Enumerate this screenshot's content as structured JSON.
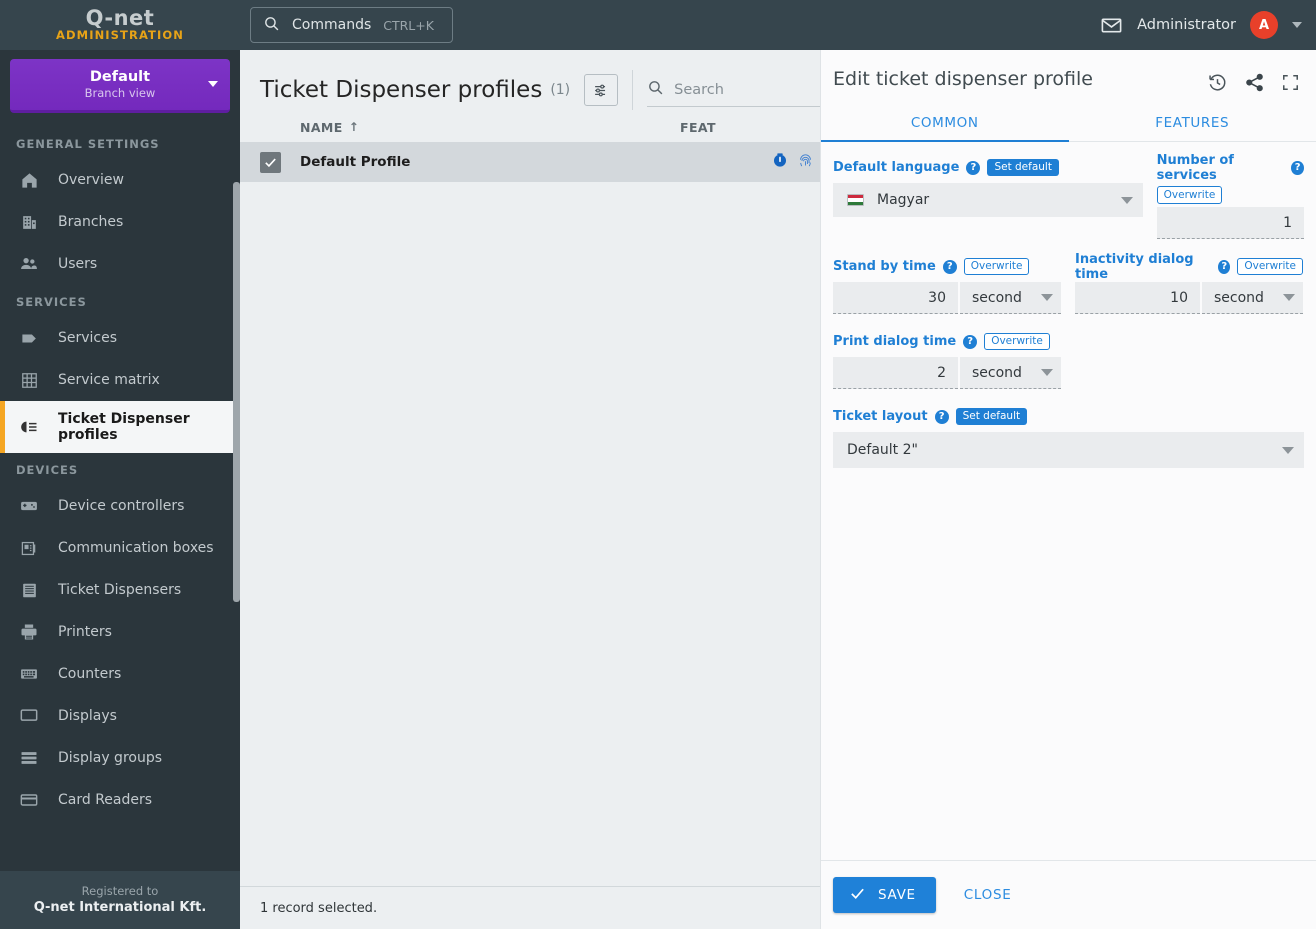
{
  "brand": {
    "logo": "Q-net",
    "subtitle": "ADMINISTRATION"
  },
  "branch": {
    "name": "Default",
    "view": "Branch view"
  },
  "topbar": {
    "commands_label": "Commands",
    "commands_shortcut": "CTRL+K",
    "user_name": "Administrator",
    "avatar_initial": "A"
  },
  "sidebar": {
    "sections": [
      {
        "title": "GENERAL SETTINGS",
        "items": [
          {
            "label": "Overview",
            "icon": "home-icon",
            "active": false
          },
          {
            "label": "Branches",
            "icon": "building-icon",
            "active": false
          },
          {
            "label": "Users",
            "icon": "users-icon",
            "active": false
          }
        ]
      },
      {
        "title": "SERVICES",
        "items": [
          {
            "label": "Services",
            "icon": "tag-icon",
            "active": false
          },
          {
            "label": "Service matrix",
            "icon": "grid-icon",
            "active": false
          },
          {
            "label": "Ticket Dispenser profiles",
            "icon": "ticket-profile-icon",
            "active": true
          }
        ]
      },
      {
        "title": "DEVICES",
        "items": [
          {
            "label": "Device controllers",
            "icon": "controller-icon",
            "active": false
          },
          {
            "label": "Communication boxes",
            "icon": "comm-box-icon",
            "active": false
          },
          {
            "label": "Ticket Dispensers",
            "icon": "ticket-dispenser-icon",
            "active": false
          },
          {
            "label": "Printers",
            "icon": "printer-icon",
            "active": false
          },
          {
            "label": "Counters",
            "icon": "counter-icon",
            "active": false
          },
          {
            "label": "Displays",
            "icon": "display-icon",
            "active": false
          },
          {
            "label": "Display groups",
            "icon": "display-groups-icon",
            "active": false
          },
          {
            "label": "Card Readers",
            "icon": "card-reader-icon",
            "active": false
          }
        ]
      }
    ],
    "footer": {
      "registered_to": "Registered to",
      "company": "Q-net International Kft."
    }
  },
  "list": {
    "title": "Ticket Dispenser profiles",
    "count": "(1)",
    "search_placeholder": "Search",
    "search_value": "",
    "columns": {
      "name": "NAME",
      "features": "FEAT"
    },
    "sort_arrow": "↑",
    "rows": [
      {
        "name": "Default Profile",
        "checked": true
      }
    ],
    "status": "1 record selected."
  },
  "panel": {
    "title": "Edit ticket dispenser profile",
    "tabs": [
      {
        "label": "COMMON",
        "active": true
      },
      {
        "label": "FEATURES",
        "active": false
      }
    ],
    "fields": {
      "default_language": {
        "label": "Default language",
        "badge": "Set default",
        "value": "Magyar",
        "flag": "hungary-flag"
      },
      "number_of_services": {
        "label": "Number of services",
        "badge": "Overwrite",
        "value": "1"
      },
      "stand_by_time": {
        "label": "Stand by time",
        "badge": "Overwrite",
        "value": "30",
        "unit": "second"
      },
      "inactivity_dialog_time": {
        "label": "Inactivity dialog time",
        "badge": "Overwrite",
        "value": "10",
        "unit": "second"
      },
      "print_dialog_time": {
        "label": "Print dialog time",
        "badge": "Overwrite",
        "value": "2",
        "unit": "second"
      },
      "ticket_layout": {
        "label": "Ticket layout",
        "badge": "Set default",
        "value": "Default 2\""
      }
    },
    "footer": {
      "save_label": "SAVE",
      "close_label": "CLOSE"
    }
  },
  "colors": {
    "sidebar_bg": "#2b363c",
    "sidebar_head_bg": "#36454d",
    "branch_purple": "#7b2fc4",
    "accent_orange": "#f5a623",
    "primary_blue": "#1f7fd4",
    "link_blue": "#2c8ce0",
    "avatar_red": "#e8402a",
    "content_bg": "#eceff1"
  }
}
